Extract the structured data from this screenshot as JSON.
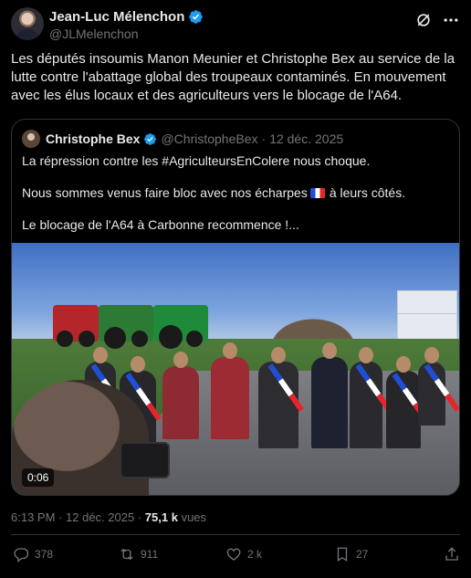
{
  "author": {
    "name": "Jean-Luc Mélenchon",
    "handle": "@JLMelenchon"
  },
  "tweet": {
    "text": "Les députés insoumis Manon Meunier et Christophe Bex au service de la lutte contre l'abattage global des troupeaux contaminés. En mouvement avec les élus locaux et des agriculteurs vers le blocage de l'A64."
  },
  "quote": {
    "name": "Christophe Bex",
    "handle": "@ChristopheBex",
    "separator": "·",
    "date": "12 déc. 2025",
    "line1": "La répression contre les #AgriculteursEnColere nous choque.",
    "line2a": "Nous sommes venus faire bloc avec nos écharpes",
    "line2b": "à leurs côtés.",
    "line3": "Le blocage de l'A64 à Carbonne recommence !...",
    "video_time": "0:06"
  },
  "meta": {
    "time": "6:13 PM",
    "separator": "·",
    "date": "12 déc. 2025",
    "separator2": "·",
    "views_count": "75,1 k",
    "views_label": "vues"
  },
  "actions": {
    "replies": "378",
    "reposts": "911",
    "likes": "2 k",
    "bookmarks": "27"
  },
  "colors": {
    "background": "#000000",
    "text": "#e7e9ea",
    "secondary": "#71767b",
    "verified": "#1d9bf0",
    "border": "#2f3336"
  }
}
